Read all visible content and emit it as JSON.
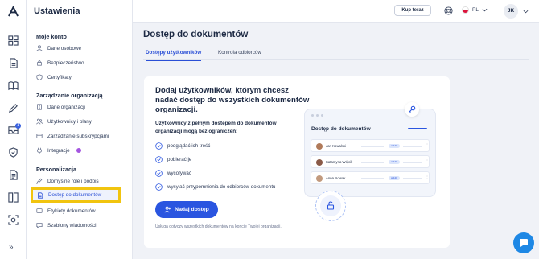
{
  "sidebar": {
    "title": "Ustawienia",
    "sections": [
      {
        "label": "Moje konto"
      },
      {
        "label": "Zarządzanie organizacją"
      },
      {
        "label": "Personalizacja"
      }
    ],
    "items": [
      {
        "label": "Dane osobowe",
        "icon": "user-icon"
      },
      {
        "label": "Bezpieczeństwo",
        "icon": "lock-icon"
      },
      {
        "label": "Certyfikaty",
        "icon": "certificate-icon"
      },
      {
        "label": "Dane organizacji",
        "icon": "building-icon"
      },
      {
        "label": "Użytkownicy i plany",
        "icon": "users-icon"
      },
      {
        "label": "Zarządzanie subskrypcjami",
        "icon": "subscription-icon"
      },
      {
        "label": "Integracje",
        "icon": "integration-icon"
      },
      {
        "label": "Domyślne role i podpis",
        "icon": "signature-icon"
      },
      {
        "label": "Dostęp do dokumentów",
        "icon": "document-icon"
      },
      {
        "label": "Etykiety dokumentów",
        "icon": "tag-icon"
      },
      {
        "label": "Szablony wiadomości",
        "icon": "message-icon"
      }
    ]
  },
  "topbar": {
    "buy_label": "Kup teraz",
    "language": "PL",
    "user_initials": "JK"
  },
  "main": {
    "title": "Dostęp do dokumentów",
    "tabs": [
      {
        "label": "Dostępy użytkowników"
      },
      {
        "label": "Kontrola odbiorców"
      }
    ],
    "card": {
      "heading": "Dodaj użytkowników, którym chcesz nadać dostęp do wszystkich dokumentów organizacji.",
      "subheading": "Użytkownicy z pełnym dostępem do dokumentów organizacji mogą bez ograniczeń:",
      "features": [
        "podglądać ich treść",
        "pobierać je",
        "wycofywać",
        "wysyłać przypomnienia do odbiorców dokumentu"
      ],
      "cta_label": "Nadaj dostęp",
      "note": "Usługa dotyczy wszystkich dokumentów na koncie Twojej organizacji."
    },
    "illustration": {
      "title": "Dostęp do dokumentów",
      "rows": [
        {
          "name": "Jan Kowalski",
          "pill": "● 120"
        },
        {
          "name": "Katarzyna Wójcik",
          "pill": "● 120"
        },
        {
          "name": "Anna Nowak",
          "pill": "● 120"
        }
      ]
    }
  },
  "colors": {
    "accent": "#2a55e0",
    "highlight": "#f1c40f",
    "chat": "#1e88e5"
  }
}
